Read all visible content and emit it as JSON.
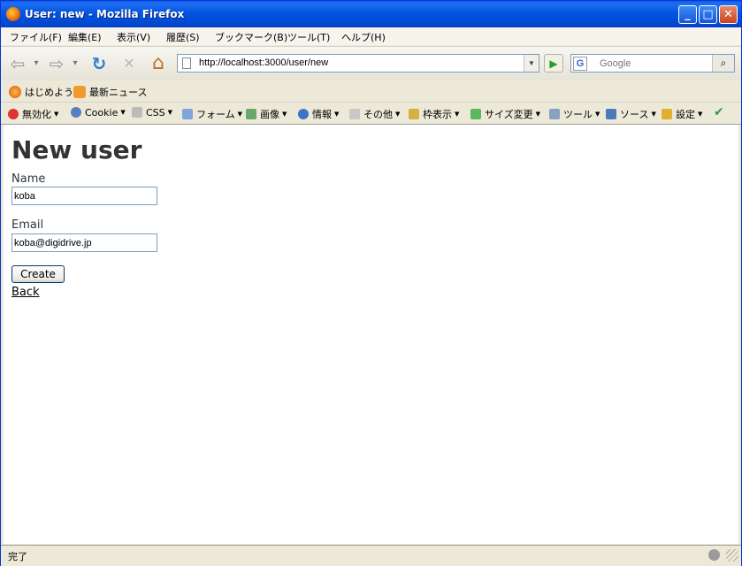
{
  "window": {
    "title": "User: new - Mozilla Firefox",
    "min": "_",
    "max": "□",
    "close": "✕"
  },
  "menu": [
    "ファイル(F)",
    "編集(E)",
    "表示(V)",
    "履歴(S)",
    "ブックマーク(B)",
    "ツール(T)",
    "ヘルプ(H)"
  ],
  "nav": {
    "back_glyph": "⇦",
    "dropdown_glyph": "▾",
    "forward_glyph": "⇨",
    "reload_glyph": "↻",
    "stop_glyph": "✕",
    "home_glyph": "⌂",
    "url": "http://localhost:3000/user/new",
    "url_dropdown_glyph": "▼",
    "go_glyph": "▶",
    "search_engine_glyph": "G",
    "search_placeholder": "Google",
    "search_glyph": "⌕"
  },
  "bookmarks": [
    "はじめよう",
    "最新ニュース"
  ],
  "webdev_toolbar": [
    "無効化",
    "Cookie",
    "CSS",
    "フォーム",
    "画像",
    "情報",
    "その他",
    "枠表示",
    "サイズ変更",
    "ツール",
    "ソース",
    "設定"
  ],
  "webdev_dropdown_glyph": "▼",
  "webdev_check_glyph": "✔",
  "page": {
    "heading": "New user",
    "name_label": "Name",
    "name_value": "koba",
    "email_label": "Email",
    "email_value": "koba@digidrive.jp",
    "submit_label": "Create",
    "back_link": "Back"
  },
  "status": {
    "text": "完了"
  },
  "colors": {
    "titlebar": "#0355e2",
    "chrome": "#ece9d8",
    "heading": "#333333",
    "go_green": "#2a9b2a"
  }
}
